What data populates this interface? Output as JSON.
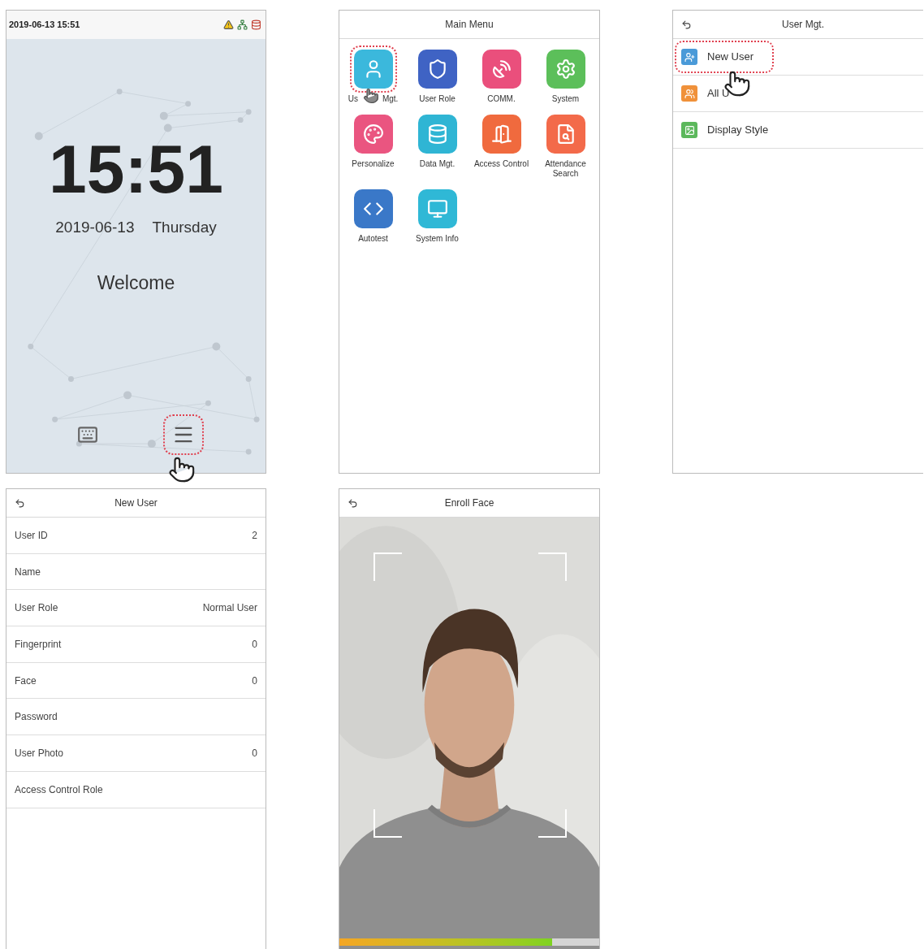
{
  "home_screen": {
    "status_time": "2019-06-13 15:51",
    "clock": "15:51",
    "date": "2019-06-13",
    "weekday": "Thursday",
    "greeting": "Welcome",
    "menu_button": {
      "highlighted": true
    }
  },
  "main_menu": {
    "title": "Main Menu",
    "items": [
      {
        "label": "Us",
        "label_tail": "Mgt.",
        "color": "#3bb8dc",
        "highlighted": true
      },
      {
        "label": "User Role",
        "color": "#3f63c4",
        "highlighted": false
      },
      {
        "label": "COMM.",
        "color": "#ea4f7c",
        "highlighted": false
      },
      {
        "label": "System",
        "color": "#5cbf5a",
        "highlighted": false
      },
      {
        "label": "Personalize",
        "color": "#ea5580",
        "highlighted": false
      },
      {
        "label": "Data Mgt.",
        "color": "#2fb5d4",
        "highlighted": false
      },
      {
        "label": "Access Control",
        "color": "#f06a3e",
        "highlighted": false
      },
      {
        "label": "Attendance Search",
        "color": "#f36a4a",
        "highlighted": false
      },
      {
        "label": "Autotest",
        "color": "#3a78c8",
        "highlighted": false
      },
      {
        "label": "System Info",
        "color": "#2fb8d6",
        "highlighted": false
      }
    ]
  },
  "user_mgt": {
    "title": "User Mgt.",
    "items": [
      {
        "label": "New User",
        "color": "#4a9ad8",
        "highlighted": true
      },
      {
        "label": "All U",
        "color": "#f0913a",
        "highlighted": false
      },
      {
        "label": "Display Style",
        "color": "#5cb85c",
        "highlighted": false
      }
    ]
  },
  "new_user": {
    "title": "New User",
    "fields": [
      {
        "label": "User ID",
        "value": "2"
      },
      {
        "label": "Name"
      },
      {
        "label": "User Role",
        "value": "Normal User"
      },
      {
        "label": "Fingerprint",
        "value": "0"
      },
      {
        "label": "Face",
        "value": "0"
      },
      {
        "label": "Password"
      },
      {
        "label": "User Photo",
        "value": "0"
      },
      {
        "label": "Access Control Role"
      }
    ]
  },
  "enroll_face": {
    "title": "Enroll Face",
    "progress": {
      "level": 0.82
    }
  }
}
